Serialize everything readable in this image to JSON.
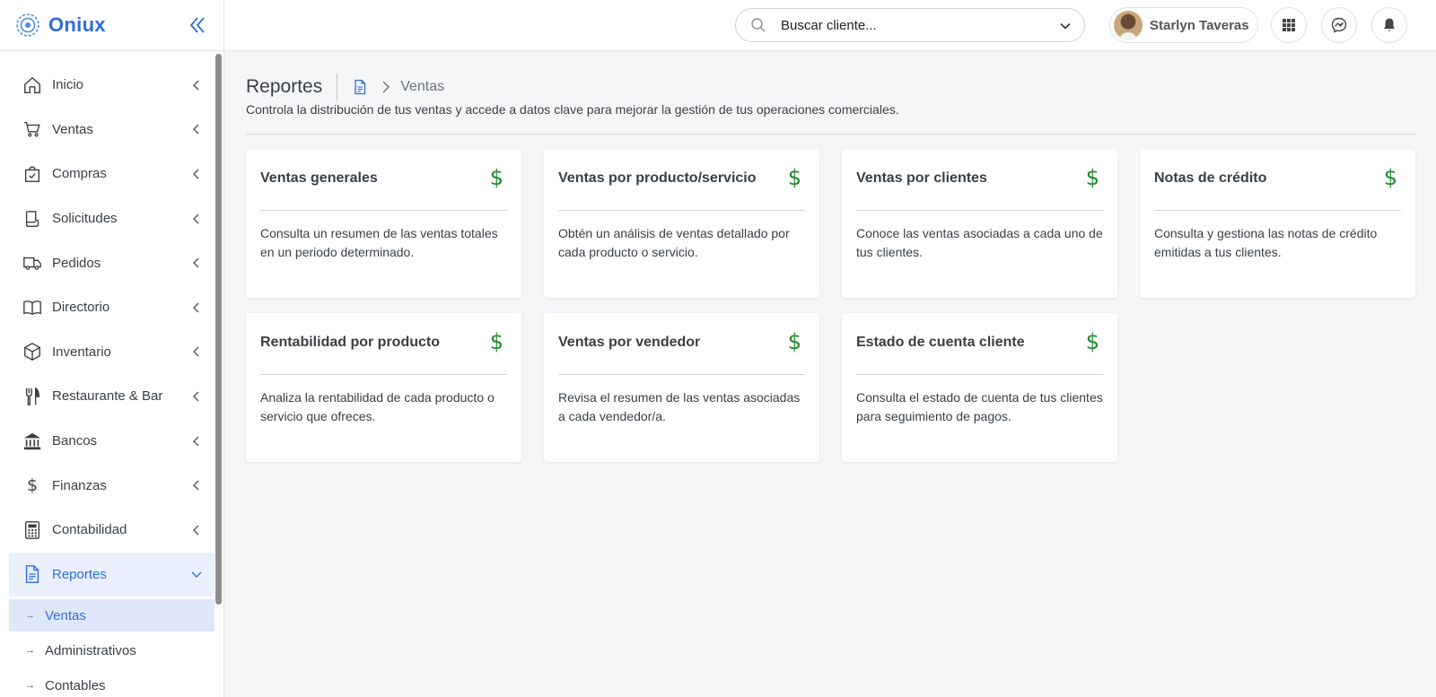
{
  "app": {
    "name": "Oniux"
  },
  "sidebar": {
    "items": [
      {
        "label": "Inicio",
        "icon": "home-icon"
      },
      {
        "label": "Ventas",
        "icon": "cart-icon"
      },
      {
        "label": "Compras",
        "icon": "bag-check-icon"
      },
      {
        "label": "Solicitudes",
        "icon": "receipt-icon"
      },
      {
        "label": "Pedidos",
        "icon": "truck-icon"
      },
      {
        "label": "Directorio",
        "icon": "book-icon"
      },
      {
        "label": "Inventario",
        "icon": "box-icon"
      },
      {
        "label": "Restaurante & Bar",
        "icon": "cutlery-icon"
      },
      {
        "label": "Bancos",
        "icon": "bank-icon"
      },
      {
        "label": "Finanzas",
        "icon": "dollar-icon"
      },
      {
        "label": "Contabilidad",
        "icon": "calculator-icon"
      },
      {
        "label": "Reportes",
        "icon": "document-icon",
        "active": true
      }
    ],
    "subitems": [
      {
        "label": "Ventas",
        "active": true
      },
      {
        "label": "Administrativos"
      },
      {
        "label": "Contables"
      }
    ]
  },
  "header": {
    "search": {
      "placeholder": "Buscar cliente..."
    },
    "user": {
      "name": "Starlyn Taveras"
    }
  },
  "page": {
    "title": "Reportes",
    "breadcrumb_current": "Ventas",
    "subtitle": "Controla la distribución de tus ventas y accede a datos clave para mejorar la gestión de tus operaciones comerciales."
  },
  "cards": [
    {
      "title": "Ventas generales",
      "desc": "Consulta un resumen de las ventas totales en un periodo determinado.",
      "icon": "$"
    },
    {
      "title": "Ventas por producto/servicio",
      "desc": "Obtén un análisis de ventas detallado por cada producto o servicio.",
      "icon": "$"
    },
    {
      "title": "Ventas por clientes",
      "desc": "Conoce las ventas asociadas a cada uno de tus clientes.",
      "icon": "$"
    },
    {
      "title": "Notas de crédito",
      "desc": "Consulta y gestiona las notas de crédito emitidas a tus clientes.",
      "icon": "$"
    },
    {
      "title": "Rentabilidad por producto",
      "desc": "Analiza la rentabilidad de cada producto o servicio que ofreces.",
      "icon": "$"
    },
    {
      "title": "Ventas por vendedor",
      "desc": "Revisa el resumen de las ventas asociadas a cada vendedor/a.",
      "icon": "$"
    },
    {
      "title": "Estado de cuenta cliente",
      "desc": "Consulta el estado de cuenta de tus clientes para seguimiento de pagos.",
      "icon": "$"
    }
  ],
  "colors": {
    "accent": "#2e6ddf",
    "dollar": "#1f8a2e",
    "active_bg": "#e9f0fc"
  }
}
